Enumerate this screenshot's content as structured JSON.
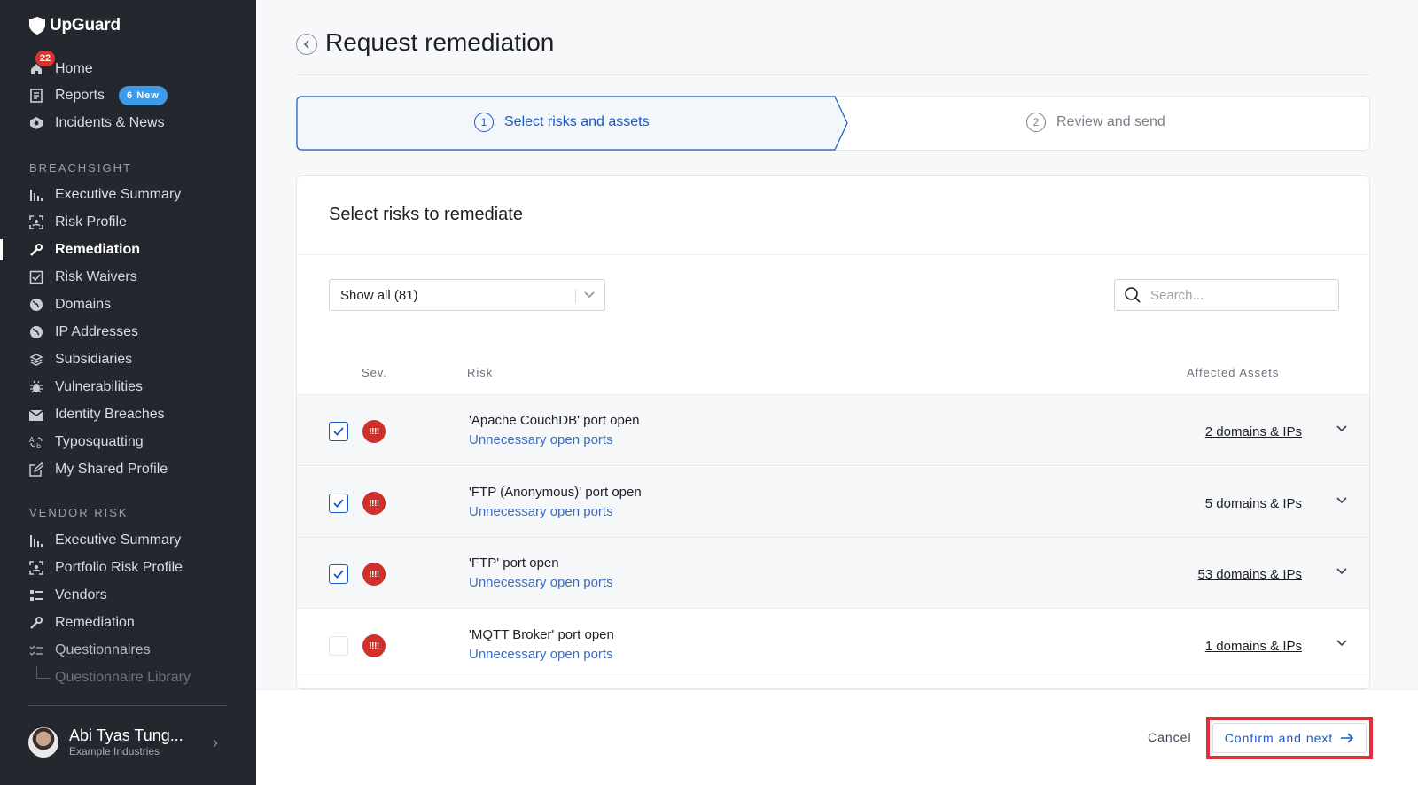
{
  "sidebar": {
    "logo": "UpGuard",
    "home": {
      "label": "Home",
      "badge": "22"
    },
    "reports": {
      "label": "Reports",
      "badge": "6 New"
    },
    "incidents": {
      "label": "Incidents & News"
    },
    "breachsight_label": "BREACHSIGHT",
    "breachsight_items": [
      "Executive Summary",
      "Risk Profile",
      "Remediation",
      "Risk Waivers",
      "Domains",
      "IP Addresses",
      "Subsidiaries",
      "Vulnerabilities",
      "Identity Breaches",
      "Typosquatting",
      "My Shared Profile"
    ],
    "vendor_label": "VENDOR RISK",
    "vendor_items": [
      "Executive Summary",
      "Portfolio Risk Profile",
      "Vendors",
      "Remediation",
      "Questionnaires",
      "Questionnaire Library"
    ],
    "user": {
      "name": "Abi Tyas Tung...",
      "org": "Example Industries"
    }
  },
  "page": {
    "title": "Request remediation",
    "steps": [
      {
        "num": "1",
        "label": "Select risks and assets"
      },
      {
        "num": "2",
        "label": "Review and send"
      }
    ]
  },
  "card": {
    "title": "Select risks to remediate",
    "filter_value": "Show all (81)",
    "search_placeholder": "Search...",
    "columns": {
      "sev": "Sev.",
      "risk": "Risk",
      "assets": "Affected Assets"
    },
    "rows": [
      {
        "name": "'Apache CouchDB' port open",
        "category": "Unnecessary open ports",
        "assets": "2 domains & IPs",
        "checked": true,
        "sev": "!!!!"
      },
      {
        "name": "'FTP (Anonymous)' port open",
        "category": "Unnecessary open ports",
        "assets": "5 domains & IPs",
        "checked": true,
        "sev": "!!!!"
      },
      {
        "name": "'FTP' port open",
        "category": "Unnecessary open ports",
        "assets": "53 domains & IPs",
        "checked": true,
        "sev": "!!!!"
      },
      {
        "name": "'MQTT Broker' port open",
        "category": "Unnecessary open ports",
        "assets": "1 domains & IPs",
        "checked": false,
        "sev": "!!!!"
      }
    ]
  },
  "footer": {
    "cancel": "Cancel",
    "confirm": "Confirm and next"
  },
  "colors": {
    "accent": "#1759c6",
    "sidebar_bg": "#25272e",
    "severity": "#d12f2c",
    "highlight": "#e0313a"
  }
}
